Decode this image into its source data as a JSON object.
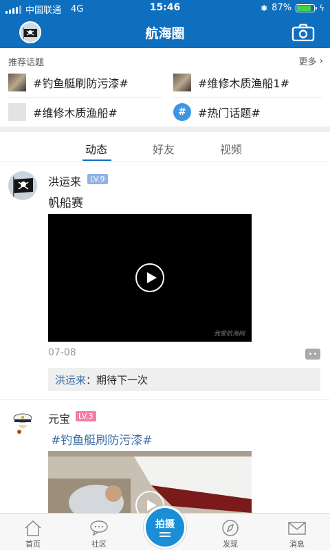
{
  "status_bar": {
    "carrier": "中国联通",
    "network": "4G",
    "time": "15:46",
    "battery_percent": "87%",
    "battery_level": 0.87
  },
  "header": {
    "title": "航海圈"
  },
  "topics": {
    "label": "推荐话题",
    "more": "更多",
    "items": [
      {
        "label": "#钓鱼艇刷防污漆#",
        "thumb": "photo"
      },
      {
        "label": "#维修木质渔船1#",
        "thumb": "photo"
      },
      {
        "label": "#维修木质渔船#",
        "thumb": "gray"
      },
      {
        "label": "#热门话题#",
        "thumb": "hash-icon"
      }
    ]
  },
  "tabs": [
    {
      "label": "动态",
      "active": true
    },
    {
      "label": "好友"
    },
    {
      "label": "视频"
    }
  ],
  "posts": [
    {
      "username": "洪运来",
      "level": "LV.9",
      "level_color": "#8fb3e6",
      "text": "帆船赛",
      "watermark": "我爱航海网",
      "date": "07-08",
      "comment": {
        "user": "洪运来",
        "separator": "：",
        "text": "期待下一次"
      }
    },
    {
      "username": "元宝",
      "level": "LV.3",
      "level_color": "#f47fa3",
      "topic": "#钓鱼艇刷防污漆#"
    }
  ],
  "bottom_nav": {
    "home": "首页",
    "community": "社区",
    "shoot": "拍摄",
    "discover": "发现",
    "messages": "消息"
  },
  "colors": {
    "brand_blue": "#0f6fbf",
    "shoot_blue": "#1a8fd8",
    "topic_blue": "#3b6ea5"
  }
}
